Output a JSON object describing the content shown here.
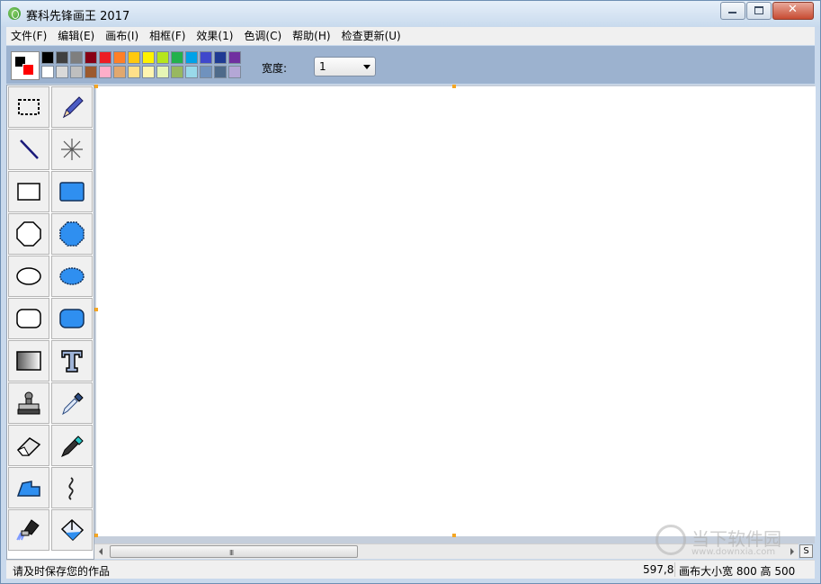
{
  "window": {
    "title": "赛科先锋画王 2017",
    "buttons": {
      "minimize": "minimize",
      "maximize": "maximize",
      "close": "close"
    }
  },
  "menu": [
    "文件(F)",
    "编辑(E)",
    "画布(I)",
    "相框(F)",
    "效果(1)",
    "色调(C)",
    "帮助(H)",
    "检查更新(U)"
  ],
  "palette": {
    "foreground": "#000000",
    "background": "#ff0000",
    "colors": [
      "#000000",
      "#404040",
      "#7f7f7f",
      "#880015",
      "#ed1c24",
      "#ff7f27",
      "#ffc90e",
      "#fff200",
      "#b5e61d",
      "#22b14c",
      "#00a2e8",
      "#3f48cc",
      "#1f3a93",
      "#7030a0",
      "#ffffff",
      "#d9d9d9",
      "#bfbfbf",
      "#9c5a2e",
      "#ffaec9",
      "#e1a86f",
      "#ffe08a",
      "#fff5b0",
      "#e6f5b5",
      "#98b860",
      "#99d9ea",
      "#7092be",
      "#4e6a8a",
      "#b4a7d6"
    ]
  },
  "width_control": {
    "label": "宽度:",
    "value": "1"
  },
  "tools": [
    "rect-select-icon",
    "pencil-icon",
    "line-icon",
    "spray-icon",
    "rectangle-icon",
    "filled-rectangle-icon",
    "octagon-icon",
    "filled-octagon-icon",
    "ellipse-icon",
    "filled-ellipse-icon",
    "rounded-rect-icon",
    "filled-rounded-rect-icon",
    "gradient-icon",
    "text-icon",
    "stamp-icon",
    "eyedropper-icon",
    "eraser-icon",
    "marker-icon",
    "polygon-fill-icon",
    "curve-icon",
    "brush-icon",
    "paint-bucket-icon"
  ],
  "scrollbar": {
    "grip": "III",
    "corner_button": "S"
  },
  "status": {
    "message": "请及时保存您的作品",
    "coords": "597,8",
    "canvas_size": "画布大小宽 800 高 500"
  },
  "watermark": {
    "text": "当下软件园",
    "url": "www.downxia.com"
  }
}
